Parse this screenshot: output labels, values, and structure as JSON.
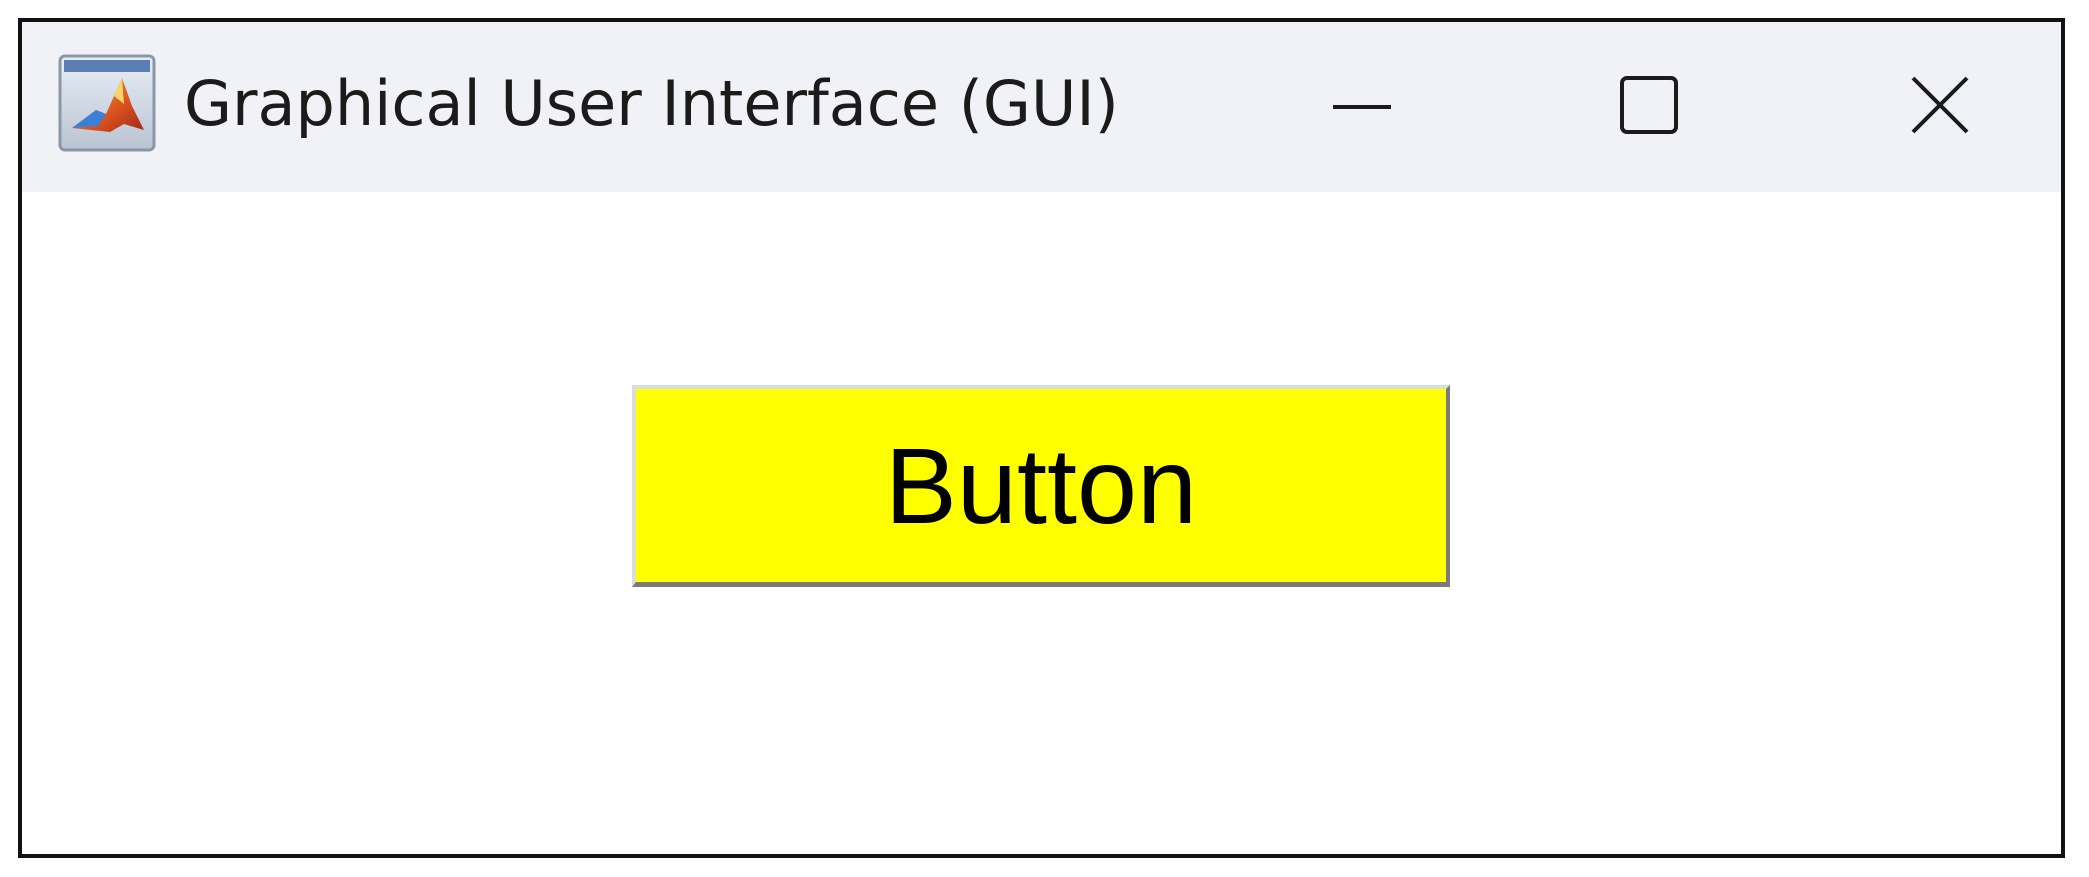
{
  "window": {
    "title": "Graphical User Interface (GUI)",
    "app_icon": "matlab-logo-icon",
    "controls": {
      "minimize_icon": "minimize-icon",
      "maximize_icon": "maximize-icon",
      "close_icon": "close-icon"
    },
    "titlebar_color": "#f1f2f7",
    "frame_color": "#111111"
  },
  "content": {
    "button": {
      "label": "Button",
      "background_color": "#ffff00",
      "text_color": "#000000"
    }
  }
}
